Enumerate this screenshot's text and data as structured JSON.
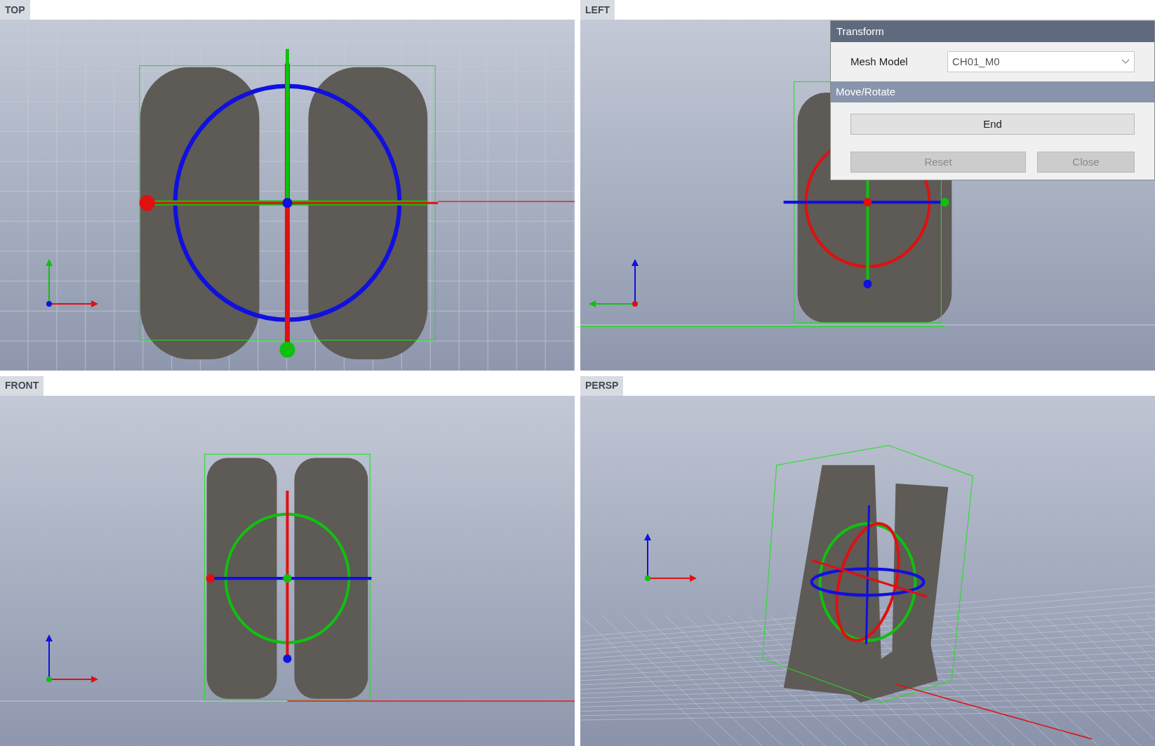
{
  "viewports": [
    {
      "label": "TOP",
      "kind": "top"
    },
    {
      "label": "LEFT",
      "kind": "left"
    },
    {
      "label": "FRONT",
      "kind": "front"
    },
    {
      "label": "PERSP",
      "kind": "persp"
    }
  ],
  "transform_panel": {
    "title": "Transform",
    "mesh_model": {
      "label": "Mesh Model",
      "value": "CH01_M0"
    },
    "section": "Move/Rotate",
    "buttons": [
      {
        "label": "End",
        "disabled": false
      },
      {
        "label": "Reset",
        "disabled": true
      },
      {
        "label": "Close",
        "disabled": true
      }
    ]
  }
}
